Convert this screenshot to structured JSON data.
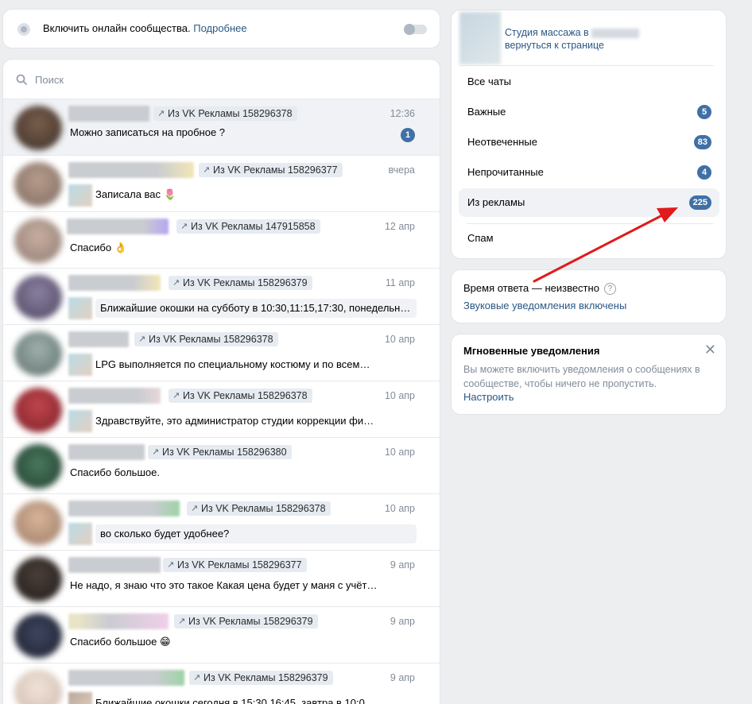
{
  "online": {
    "text": "Включить онлайн сообщества.",
    "link": "Подробнее"
  },
  "search": {
    "placeholder": "Поиск"
  },
  "dialogs": [
    {
      "tag": "Из VK Рекламы 158296378",
      "time": "12:36",
      "message": "Можно записаться на пробное ?",
      "unread": "1"
    },
    {
      "tag": "Из VK Рекламы 158296377",
      "time": "вчера",
      "message": "Записала вас 🌷"
    },
    {
      "tag": "Из VK Рекламы 147915858",
      "time": "12 апр",
      "message": "Спасибо 👌"
    },
    {
      "tag": "Из VK Рекламы 158296379",
      "time": "11 апр",
      "message": "Ближайшие окошки на субботу в 10:30,11:15,17:30, понедельни…"
    },
    {
      "tag": "Из VK Рекламы 158296378",
      "time": "10 апр",
      "message": "LPG выполняется по специальному костюму и по всем…"
    },
    {
      "tag": "Из VK Рекламы 158296378",
      "time": "10 апр",
      "message": "Здравствуйте, это администратор студии коррекции фи…"
    },
    {
      "tag": "Из VK Рекламы 158296380",
      "time": "10 апр",
      "message": "Спасибо большое."
    },
    {
      "tag": "Из VK Рекламы 158296378",
      "time": "10 апр",
      "message": "во сколько будет удобнее?"
    },
    {
      "tag": "Из VK Рекламы 158296377",
      "time": "9 апр",
      "message": "Не надо, я знаю что это такое Какая цена будет у маня с учёт…"
    },
    {
      "tag": "Из VK Рекламы 158296379",
      "time": "9 апр",
      "message": "Спасибо большое 😁"
    },
    {
      "tag": "Из VK Рекламы 158296379",
      "time": "9 апр",
      "message": "Ближайшие окошки сегодня в 15:30,16:45, завтра в 10:0…"
    }
  ],
  "community": {
    "name": "Студия массажа в",
    "back": "вернуться к странице"
  },
  "folders": [
    {
      "label": "Все чаты"
    },
    {
      "label": "Важные",
      "count": "5"
    },
    {
      "label": "Неотвеченные",
      "count": "83"
    },
    {
      "label": "Непрочитанные",
      "count": "4"
    },
    {
      "label": "Из рекламы",
      "count": "225"
    },
    {
      "label": "Спам"
    }
  ],
  "response": {
    "time": "Время ответа — неизвестно",
    "help": "?",
    "sound": "Звуковые уведомления включены"
  },
  "notify": {
    "title": "Мгновенные уведомления",
    "body": "Вы можете включить уведомления о сообщениях в сообществе, чтобы ничего не пропустить.",
    "link": "Настроить",
    "close": "✕"
  },
  "icons": {
    "search": "search-icon",
    "tag_arrow": "arrow-up-right-icon",
    "close": "close-icon",
    "help": "question-icon"
  },
  "colors": {
    "accent": "#2a5885",
    "badge": "#3f70a6",
    "annotation_arrow": "#e01b1b",
    "page_bg": "#edeef0"
  }
}
